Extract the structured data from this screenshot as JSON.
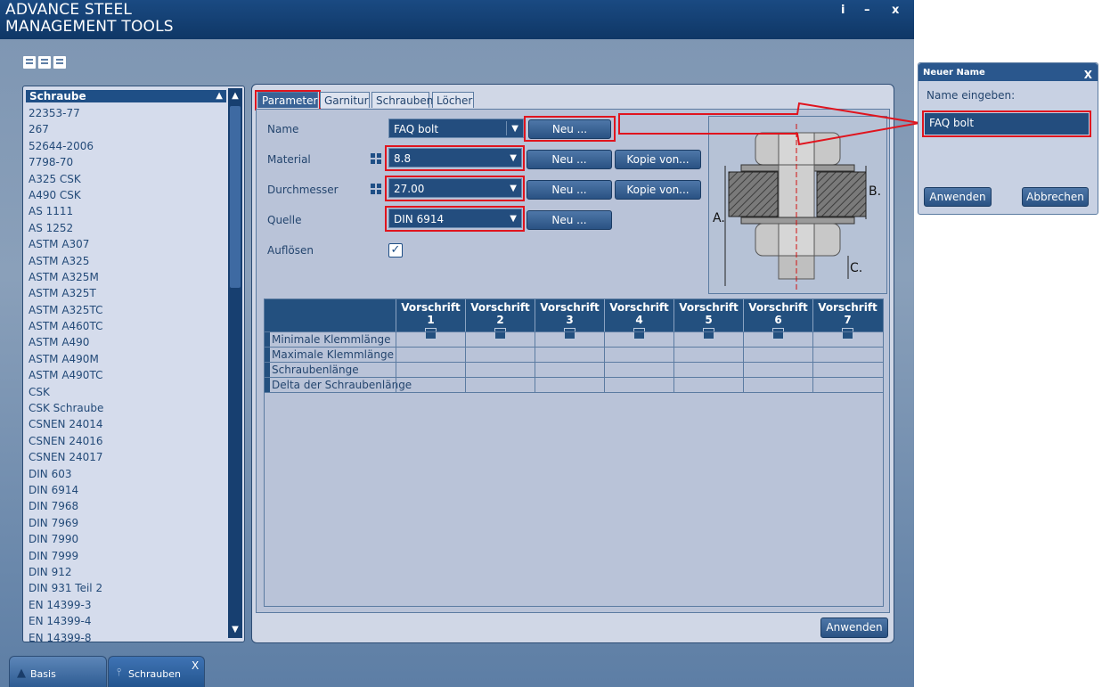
{
  "app": {
    "title": "ADVANCE STEEL\nMANAGEMENT TOOLS",
    "btn_info": "i",
    "btn_min": "–",
    "btn_close": "x"
  },
  "list": {
    "header": "Schraube",
    "items": [
      "22353-77",
      "267",
      "52644-2006",
      "7798-70",
      "A325 CSK",
      "A490 CSK",
      "AS 1111",
      "AS 1252",
      "ASTM A307",
      "ASTM A325",
      "ASTM A325M",
      "ASTM A325T",
      "ASTM A325TC",
      "ASTM A460TC",
      "ASTM A490",
      "ASTM A490M",
      "ASTM A490TC",
      "CSK",
      "CSK Schraube",
      "CSNEN 24014",
      "CSNEN 24016",
      "CSNEN 24017",
      "DIN 603",
      "DIN 6914",
      "DIN 7968",
      "DIN 7969",
      "DIN 7990",
      "DIN 7999",
      "DIN 912",
      "DIN 931 Teil 2",
      "EN 14399-3",
      "EN 14399-4",
      "EN 14399-8"
    ]
  },
  "tabs": [
    "Parameter",
    "Garnitur",
    "Schrauben",
    "Löcher"
  ],
  "form": {
    "name_label": "Name",
    "name_value": "FAQ bolt",
    "material_label": "Material",
    "material_value": "8.8",
    "durchmesser_label": "Durchmesser",
    "durchmesser_value": "27.00",
    "quelle_label": "Quelle",
    "quelle_value": "DIN 6914",
    "aufloesen_label": "Auflösen",
    "aufloesen_checked": true,
    "neu": "Neu ...",
    "kopie": "Kopie von..."
  },
  "diagram": {
    "label_a": "A.",
    "label_b": "B.",
    "label_c": "C."
  },
  "table": {
    "columns": [
      "Vorschrift 1",
      "Vorschrift 2",
      "Vorschrift 3",
      "Vorschrift 4",
      "Vorschrift 5",
      "Vorschrift 6",
      "Vorschrift 7"
    ],
    "rows": [
      "Minimale Klemmlänge",
      "Maximale Klemmlänge",
      "Schraubenlänge",
      "Delta der Schraubenlänge"
    ]
  },
  "apply_label": "Anwenden",
  "bottom_tabs": {
    "basis": "Basis",
    "schrauben": "Schrauben",
    "close": "X"
  },
  "dialog": {
    "title": "Neuer Name",
    "close": "X",
    "prompt": "Name eingeben:",
    "value": "FAQ bolt",
    "apply": "Anwenden",
    "cancel": "Abbrechen"
  },
  "colors": {
    "highlight": "#e0141e",
    "header_blue": "#1f4f86"
  }
}
